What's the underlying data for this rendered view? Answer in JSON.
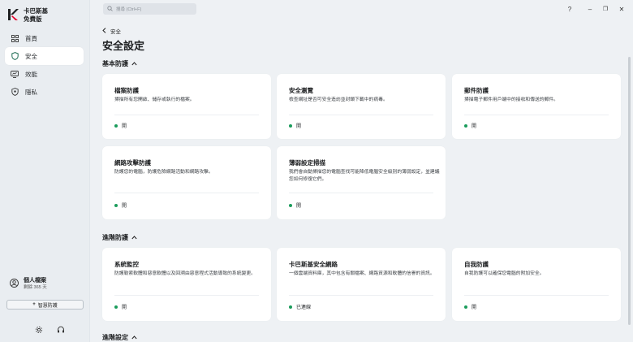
{
  "window": {
    "help": "?",
    "minimize": "–",
    "restore": "❐",
    "close": "✕"
  },
  "brand": {
    "name": "卡巴斯基",
    "edition": "免費版",
    "accent": "#e4002b"
  },
  "sidebar": {
    "items": [
      {
        "label": "首頁",
        "icon": "home-grid-icon",
        "active": false
      },
      {
        "label": "安全",
        "icon": "shield-icon",
        "active": true
      },
      {
        "label": "效能",
        "icon": "performance-icon",
        "active": false
      },
      {
        "label": "隱私",
        "icon": "privacy-icon",
        "active": false
      }
    ],
    "profile": {
      "name": "個人檔案",
      "sub": "剩餘 365 天"
    },
    "upgrade_label": "智慧防護",
    "upgrade_prefix": "+"
  },
  "search": {
    "placeholder": "搜尋 (Ctrl+F)"
  },
  "breadcrumb": {
    "back_label": "安全"
  },
  "page": {
    "title": "安全設定"
  },
  "sections": [
    {
      "title": "基本防護",
      "cards": [
        {
          "title": "檔案防護",
          "desc": "掃描所有您開啟、儲存或執行的檔案。",
          "status": "開"
        },
        {
          "title": "安全瀏覽",
          "desc": "檢查網址是否可安全造訪並封鎖下載中的病毒。",
          "status": "開"
        },
        {
          "title": "郵件防護",
          "desc": "掃描電子郵件用戶端中的接收和傳送的郵件。",
          "status": "開"
        },
        {
          "title": "網路攻擊防護",
          "desc": "防護您的電腦，防護危險網路活動和網路攻擊。",
          "status": "開"
        },
        {
          "title": "薄弱設定掃描",
          "desc": "我們會自動掃描您的電腦查找可能降低電腦安全級別的薄弱設定，並建議您如何修復它們。",
          "status": "開"
        }
      ]
    },
    {
      "title": "進階防護",
      "cards": [
        {
          "title": "系統監控",
          "desc": "防護勒索軟體和惡意軟體以及回溯由惡意程式活動導致的系統變更。",
          "status": "開"
        },
        {
          "title": "卡巴斯基安全網路",
          "desc": "一個雲端資料庫，其中包含有關檔案、網路資源和軟體的信譽的資訊。",
          "status": "已連線"
        },
        {
          "title": "自我防護",
          "desc": "自我防護可以確保您電腦的附加安全。",
          "status": "開"
        }
      ]
    },
    {
      "title": "進階設定",
      "cards": []
    }
  ],
  "colors": {
    "status_on": "#1a9c5b",
    "background": "#eef1f4"
  }
}
